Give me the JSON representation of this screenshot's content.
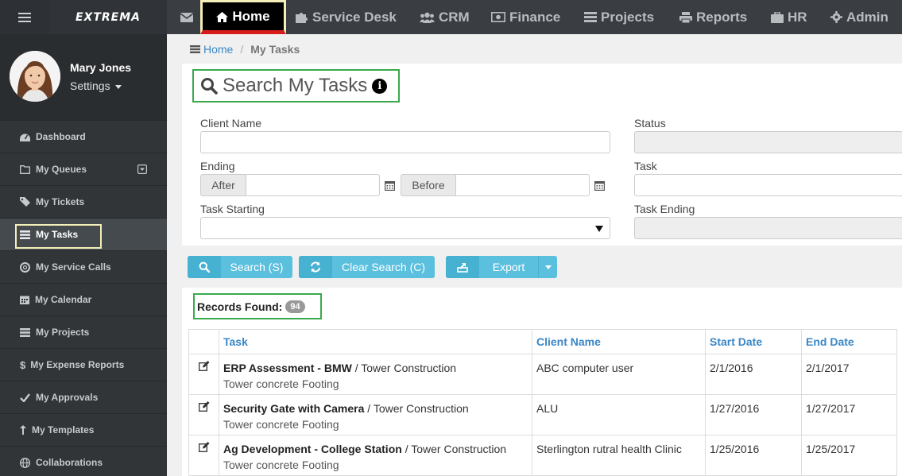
{
  "app": {
    "logo": "EXTREMA"
  },
  "topnav": {
    "home": "Home",
    "service_desk": "Service Desk",
    "crm": "CRM",
    "finance": "Finance",
    "projects": "Projects",
    "reports": "Reports",
    "hr": "HR",
    "admin": "Admin"
  },
  "profile": {
    "name": "Mary Jones",
    "settings": "Settings"
  },
  "sidebar": {
    "items": [
      {
        "label": "Dashboard",
        "icon": "dashboard-icon"
      },
      {
        "label": "My Queues",
        "icon": "folder-icon"
      },
      {
        "label": "My Tickets",
        "icon": "tag-icon"
      },
      {
        "label": "My Tasks",
        "icon": "tasks-icon",
        "active": true
      },
      {
        "label": "My Service Calls",
        "icon": "lifebuoy-icon"
      },
      {
        "label": "My Calendar",
        "icon": "calendar-icon"
      },
      {
        "label": "My Projects",
        "icon": "tasks-icon"
      },
      {
        "label": "My Expense Reports",
        "icon": "dollar-icon"
      },
      {
        "label": "My Approvals",
        "icon": "check-icon"
      },
      {
        "label": "My Templates",
        "icon": "level-up-icon"
      },
      {
        "label": "Collaborations",
        "icon": "globe-icon"
      }
    ]
  },
  "breadcrumb": {
    "home": "Home",
    "current": "My Tasks"
  },
  "search": {
    "title": "Search My Tasks",
    "client_name_label": "Client Name",
    "client_name_value": "",
    "status_label": "Status",
    "ending_label": "Ending",
    "after_label": "After",
    "before_label": "Before",
    "task_label": "Task",
    "task_starting_label": "Task Starting",
    "task_ending_label": "Task Ending"
  },
  "buttons": {
    "search": "Search (S)",
    "clear": "Clear Search (C)",
    "export": "Export"
  },
  "results": {
    "records_label": "Records Found:",
    "count": "94",
    "columns": [
      "Task",
      "Client Name",
      "Start Date",
      "End Date"
    ],
    "rows": [
      {
        "task": "ERP Assessment - BMW",
        "project": " / Tower Construction",
        "sub": "Tower concrete Footing",
        "client": "ABC computer user",
        "start": "2/1/2016",
        "end": "2/1/2017"
      },
      {
        "task": "Security Gate with Camera",
        "project": " / Tower Construction",
        "sub": "Tower concrete Footing",
        "client": "ALU",
        "start": "1/27/2016",
        "end": "1/27/2017"
      },
      {
        "task": "Ag Development - College Station",
        "project": " / Tower Construction",
        "sub": "Tower concrete Footing",
        "client": "Sterlington rutral health Clinic",
        "start": "1/25/2016",
        "end": "1/25/2017"
      }
    ]
  },
  "colors": {
    "topbar": "#3a3e42",
    "sidebar": "#323538",
    "accent": "#5bc0de",
    "link": "#3a87c6",
    "highlight_green": "#3aa94c",
    "highlight_yellow": "#f3efb8",
    "home_underline": "#d81c1c"
  }
}
